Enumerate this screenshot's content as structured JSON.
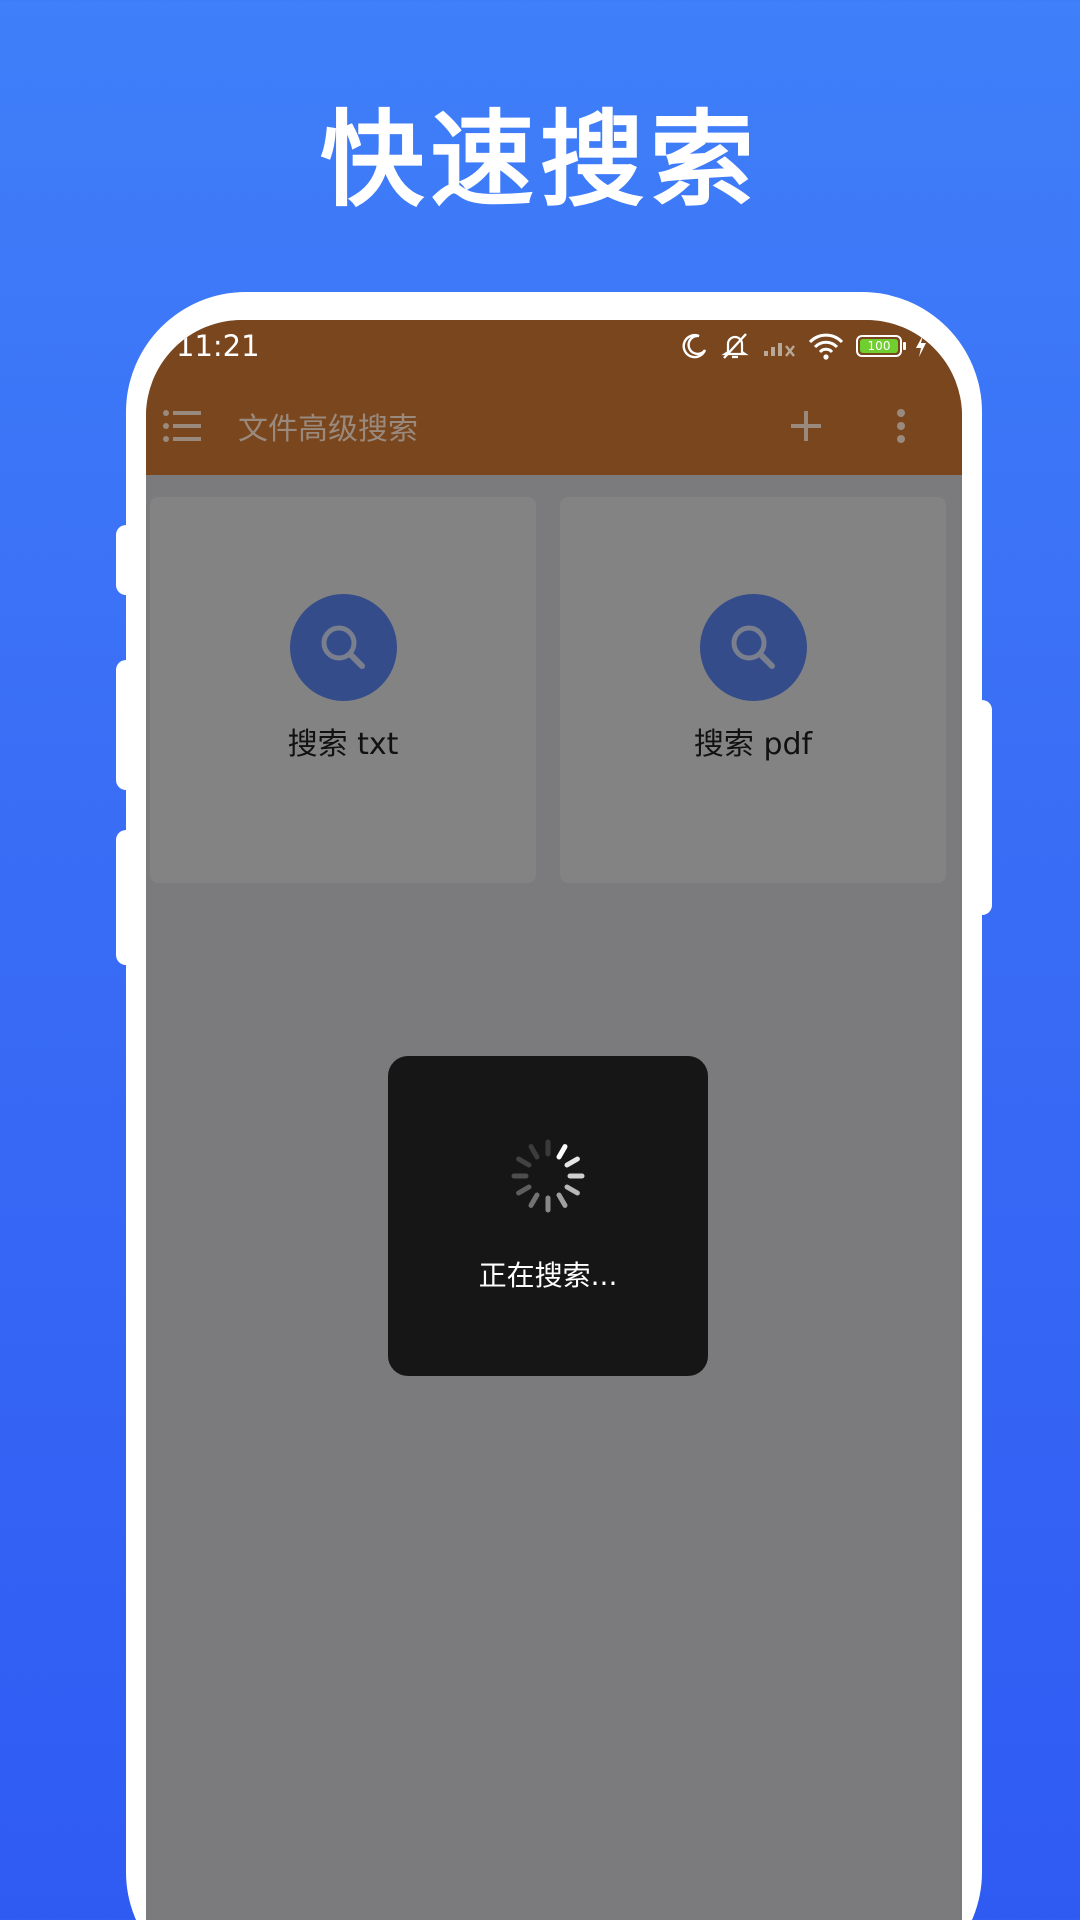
{
  "headline": "快速搜索",
  "status_bar": {
    "time": "11:21",
    "battery_level": "100",
    "icons": [
      "moon-icon",
      "silent-bell-icon",
      "signal-off-icon",
      "wifi-icon",
      "battery-icon",
      "charging-icon"
    ]
  },
  "toolbar": {
    "title": "文件高级搜索",
    "menu_icon": "menu-icon",
    "add_icon": "plus-icon",
    "more_icon": "more-vert-icon"
  },
  "cards": [
    {
      "label": "搜索 txt",
      "icon": "search-icon"
    },
    {
      "label": "搜索 pdf",
      "icon": "search-icon"
    }
  ],
  "loading": {
    "text": "正在搜索..."
  },
  "colors": {
    "background": "#3a6ef6",
    "appbar": "#7a461d",
    "screen_overlay": "#7b7b7d",
    "card": "#838384",
    "icon_circle": "#344c8a",
    "dialog": "#161616",
    "battery": "#6fcf2e"
  }
}
